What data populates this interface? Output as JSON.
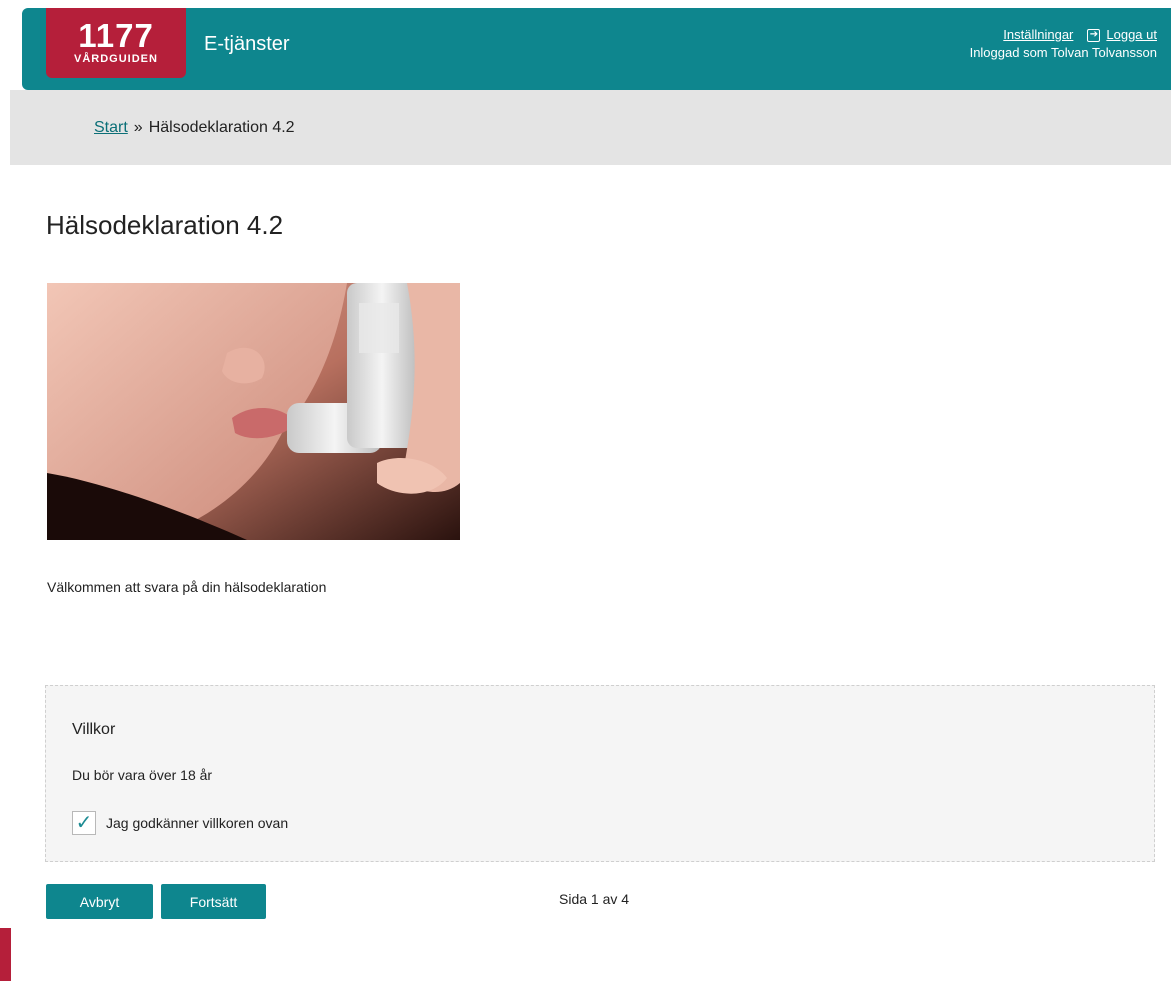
{
  "header": {
    "logo_number": "1177",
    "logo_text": "VÅRDGUIDEN",
    "service_title": "E-tjänster",
    "settings_label": "Inställningar",
    "logout_label": "Logga ut",
    "logged_in_as": "Inloggad som Tolvan Tolvansson"
  },
  "breadcrumb": {
    "start_label": "Start",
    "separator": "»",
    "current": "Hälsodeklaration 4.2"
  },
  "main": {
    "title": "Hälsodeklaration 4.2",
    "welcome_text": "Välkommen att svara på din hälsodeklaration"
  },
  "terms": {
    "title": "Villkor",
    "text": "Du bör vara över 18 år",
    "consent_label": "Jag godkänner villkoren ovan",
    "consent_checked": true
  },
  "actions": {
    "cancel_label": "Avbryt",
    "continue_label": "Fortsätt",
    "page_indicator": "Sida 1 av 4"
  },
  "colors": {
    "brand_teal": "#0e868e",
    "logo_red": "#b51f3a",
    "breadcrumb_band": "#e4e4e4"
  }
}
